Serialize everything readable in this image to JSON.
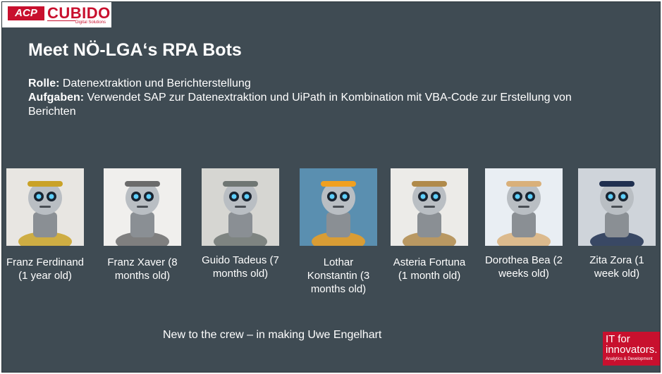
{
  "logo": {
    "acp": "ACP",
    "cubido": "CUBIDO",
    "sub": "Digital Solutions"
  },
  "title": "Meet NÖ-LGA‘s RPA Bots",
  "role": {
    "label": "Rolle:",
    "text": " Datenextraktion und Berichterstellung"
  },
  "tasks": {
    "label": "Aufgaben:",
    "text": " Verwendet SAP zur Datenextraktion und UiPath in Kombination mit VBA-Code zur Erstellung von Berichten"
  },
  "bots": [
    {
      "name": "Franz Ferdinand (1 year old)",
      "image": "bot-mustache-general-icon",
      "bg": "#e8e6e2",
      "accent": "#c9a227"
    },
    {
      "name": "Franz Xaver (8 months old)",
      "image": "bot-composer-icon",
      "bg": "#f0efed",
      "accent": "#6b6b6b"
    },
    {
      "name": "Guido Tadeus (7 months old)",
      "image": "bot-squid-icon",
      "bg": "#d6d6d2",
      "accent": "#6f7673"
    },
    {
      "name": "Lothar Konstantin (3 months old)",
      "image": "bot-orange-robot-icon",
      "bg": "#5a8fb0",
      "accent": "#f0a020"
    },
    {
      "name": "Asteria Fortuna (1 month old)",
      "image": "bot-steampunk-lady-icon",
      "bg": "#ecebe8",
      "accent": "#b08a4a"
    },
    {
      "name": "Dorothea Bea (2 weeks old)",
      "image": "bot-curly-scientist-icon",
      "bg": "#e9eef3",
      "accent": "#d9b07a"
    },
    {
      "name": "Zita Zora (1 week old)",
      "image": "bot-captain-icon",
      "bg": "#cfd4da",
      "accent": "#1f2f4f"
    }
  ],
  "new_crew": "New to the crew – in making Uwe Engelhart",
  "badge": {
    "line1": "IT for",
    "line2": "innovators.",
    "sub": "Analytics & Development"
  },
  "colors": {
    "slide_bg": "#3f4b53",
    "brand_red": "#c8102e",
    "text": "#ffffff"
  }
}
